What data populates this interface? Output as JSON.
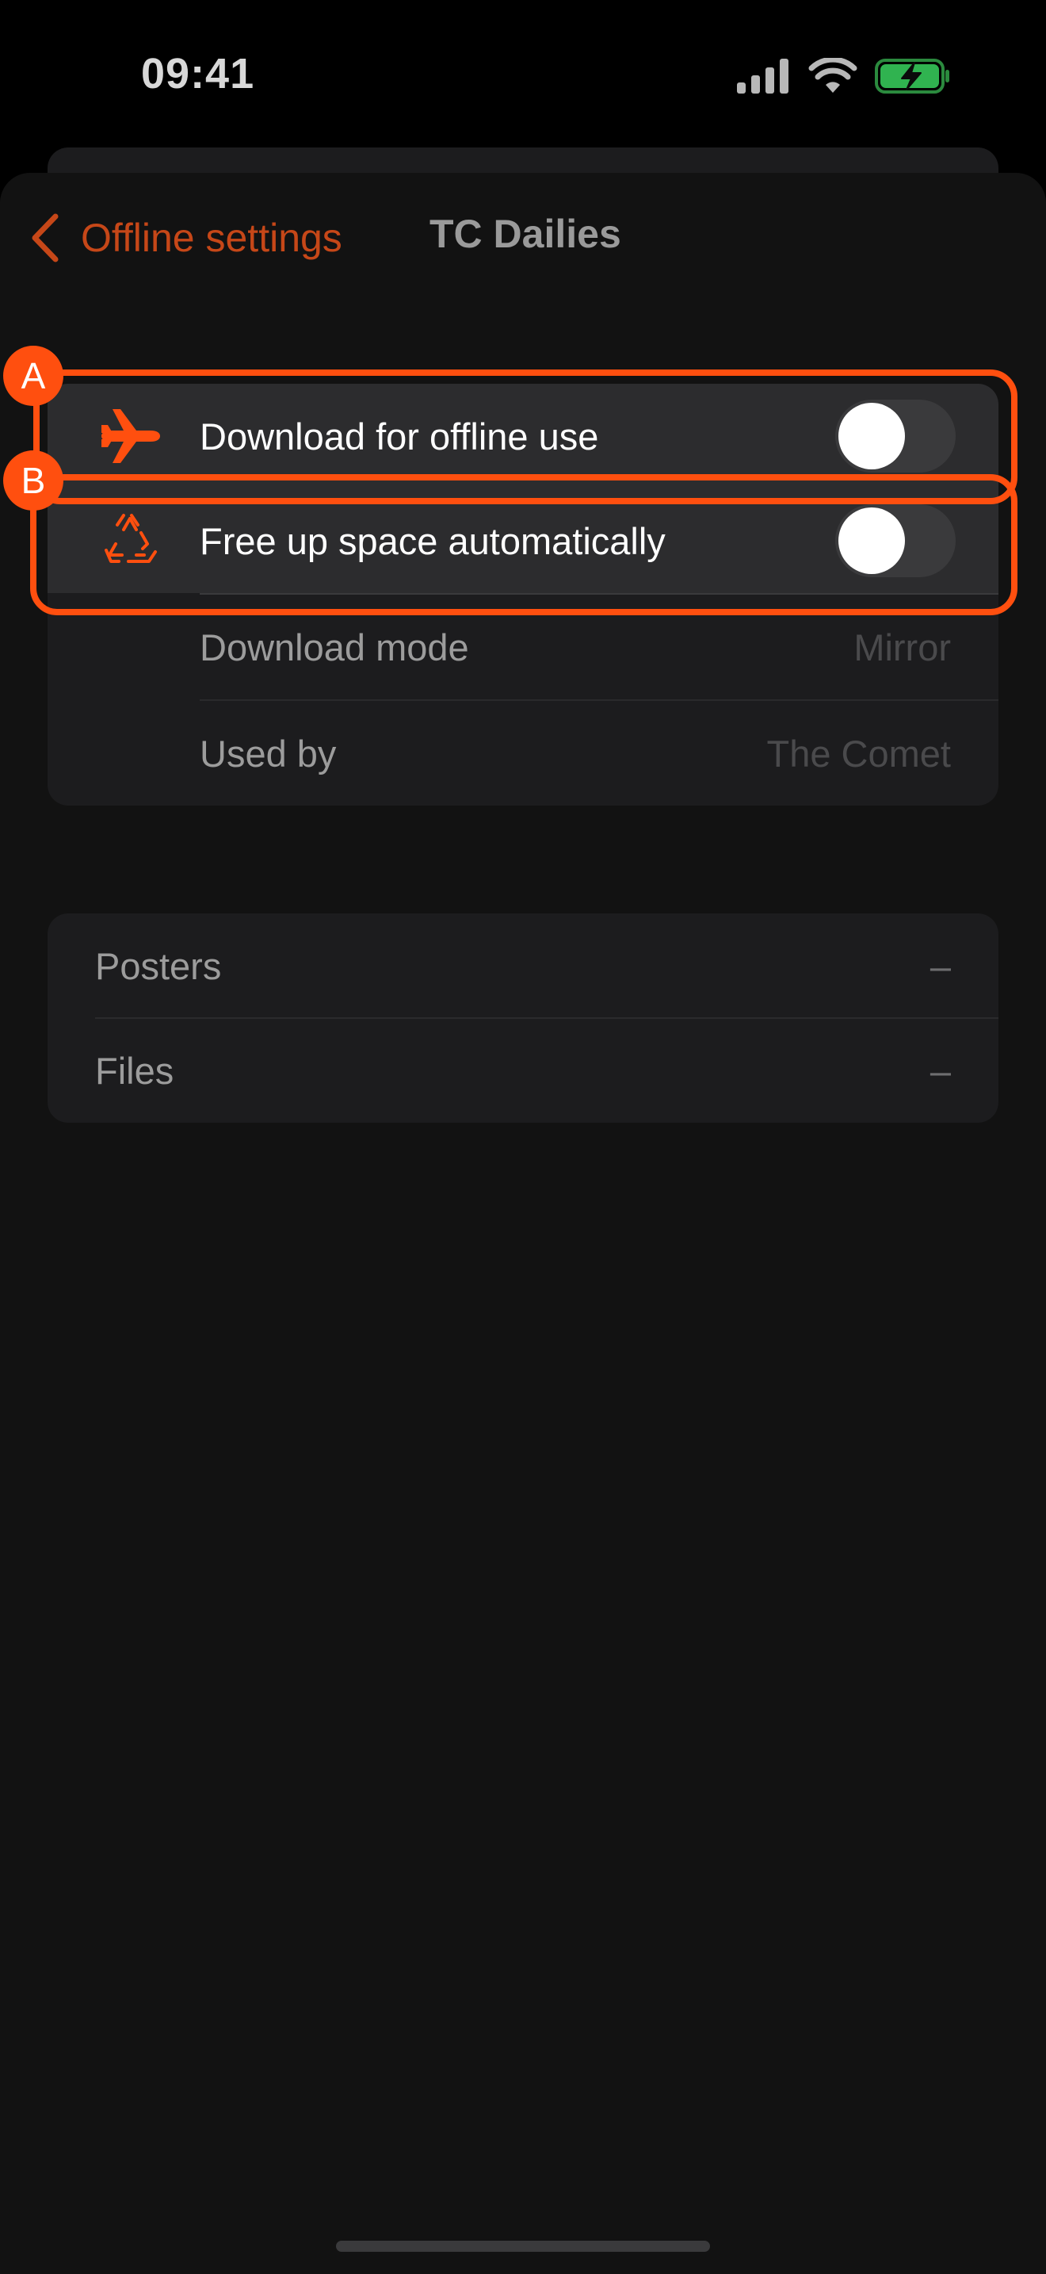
{
  "status_bar": {
    "time": "09:41",
    "icons": [
      "cellular-signal-icon",
      "wifi-icon",
      "battery-charging-icon"
    ]
  },
  "nav": {
    "back_label": "Offline settings",
    "title": "TC Dailies"
  },
  "offline_group": {
    "download_offline": {
      "label": "Download for offline use",
      "icon": "airplane-icon",
      "toggle_on": false
    },
    "free_up_space": {
      "label": "Free up space automatically",
      "icon": "recycle-icon",
      "toggle_on": false
    },
    "download_mode": {
      "label": "Download mode",
      "value": "Mirror"
    },
    "used_by": {
      "label": "Used by",
      "value": "The Comet"
    }
  },
  "storage_group": {
    "posters": {
      "label": "Posters",
      "value": "–"
    },
    "files": {
      "label": "Files",
      "value": "–"
    }
  },
  "annotations": {
    "a": "A",
    "b": "B"
  },
  "colors": {
    "accent": "#ff4f0f",
    "back_text": "#c64718",
    "battery": "#35c759"
  }
}
